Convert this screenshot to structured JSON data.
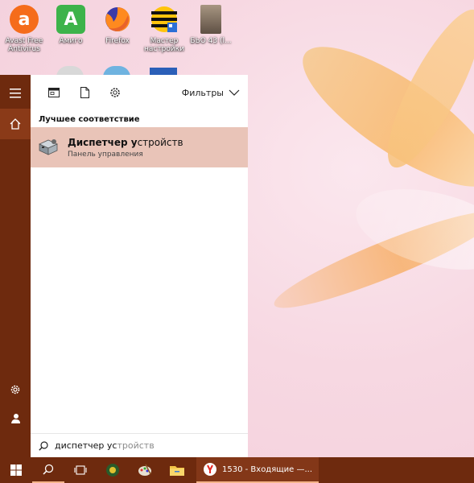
{
  "desktop": {
    "icons": [
      {
        "label": "Avast Free Antivirus",
        "icon": "avast-icon",
        "color": "#f56c1b",
        "glyph": "a"
      },
      {
        "label": "Амиго",
        "icon": "amigo-icon",
        "color": "#3db34a",
        "glyph": "A"
      },
      {
        "label": "Firefox",
        "icon": "firefox-icon",
        "color": "#e8632b",
        "glyph": ""
      },
      {
        "label": "Мастер настройки",
        "icon": "beeline-icon",
        "color": "#ffc40c",
        "glyph": ""
      },
      {
        "label": "БЬО 43 (l...",
        "icon": "photo-file-icon",
        "color": "#8a7a6a",
        "glyph": ""
      }
    ]
  },
  "start_rail": {
    "items": [
      {
        "name": "menu-icon",
        "glyph": "☰"
      },
      {
        "name": "home-icon",
        "glyph": "⌂"
      },
      {
        "name": "settings-icon",
        "glyph": "⚙"
      },
      {
        "name": "user-icon",
        "glyph": "👤"
      }
    ]
  },
  "search_panel": {
    "toolbar": {
      "filters_label": "Фильтры"
    },
    "best_match_heading": "Лучшее соответствие",
    "result": {
      "title_bold": "Диспетчер у",
      "title_rest": "стройств",
      "subtitle": "Панель управления"
    },
    "query": {
      "typed": "диспетчер ус",
      "suggested": "тройств"
    }
  },
  "taskbar": {
    "active_window_label": "1530 - Входящие —..."
  },
  "colors": {
    "accent_dark": "#6e2a0e",
    "selection": "#e9c4b8"
  }
}
